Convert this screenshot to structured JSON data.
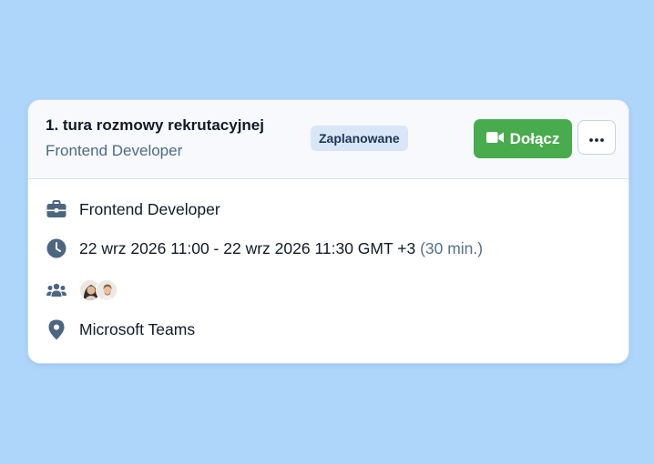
{
  "meeting": {
    "title": "1. tura rozmowy rekrutacyjnej",
    "subtitle": "Frontend Developer",
    "status_badge": "Zaplanowane",
    "join_label": "Dołącz",
    "position": "Frontend Developer",
    "datetime": "22 wrz 2026 11:00 - 22 wrz 2026 11:30 GMT +3",
    "duration": "(30 min.)",
    "location": "Microsoft Teams"
  },
  "icons": {
    "join": "video-camera-icon",
    "more": "more-horizontal-icon",
    "position": "briefcase-icon",
    "datetime": "clock-icon",
    "participants": "users-group-icon",
    "location": "map-pin-icon"
  },
  "colors": {
    "background": "#aed5fa",
    "join_button": "#48ac4e",
    "badge_bg": "#d8e6f7",
    "icon": "#4d6680"
  }
}
